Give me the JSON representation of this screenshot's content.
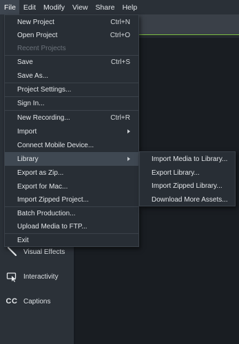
{
  "menubar": {
    "items": [
      {
        "label": "File",
        "active": true
      },
      {
        "label": "Edit",
        "active": false
      },
      {
        "label": "Modify",
        "active": false
      },
      {
        "label": "View",
        "active": false
      },
      {
        "label": "Share",
        "active": false
      },
      {
        "label": "Help",
        "active": false
      }
    ]
  },
  "file_menu": {
    "items": [
      {
        "label": "New Project",
        "shortcut": "Ctrl+N"
      },
      {
        "label": "Open Project",
        "shortcut": "Ctrl+O"
      },
      {
        "label": "Recent Projects",
        "disabled": true
      },
      {
        "label": "Save",
        "shortcut": "Ctrl+S"
      },
      {
        "label": "Save As..."
      },
      {
        "label": "Project Settings..."
      },
      {
        "label": "Sign In..."
      },
      {
        "label": "New Recording...",
        "shortcut": "Ctrl+R"
      },
      {
        "label": "Import",
        "submenu": true
      },
      {
        "label": "Connect Mobile Device..."
      },
      {
        "label": "Library",
        "submenu": true,
        "highlighted": true
      },
      {
        "label": "Export as Zip..."
      },
      {
        "label": "Export for Mac..."
      },
      {
        "label": "Import Zipped Project..."
      },
      {
        "label": "Batch Production..."
      },
      {
        "label": "Upload Media to FTP..."
      },
      {
        "label": "Exit"
      }
    ]
  },
  "library_submenu": {
    "items": [
      {
        "label": "Import Media to Library..."
      },
      {
        "label": "Export Library..."
      },
      {
        "label": "Import Zipped Library..."
      },
      {
        "label": "Download More Assets..."
      }
    ]
  },
  "tools": {
    "visual_effects": "Visual Effects",
    "interactivity": "Interactivity",
    "captions": "Captions",
    "captions_glyph": "CC"
  },
  "colors": {
    "accent_green": "#7fc241",
    "menu_bg": "#282e35",
    "menu_highlight": "#3f4852"
  }
}
